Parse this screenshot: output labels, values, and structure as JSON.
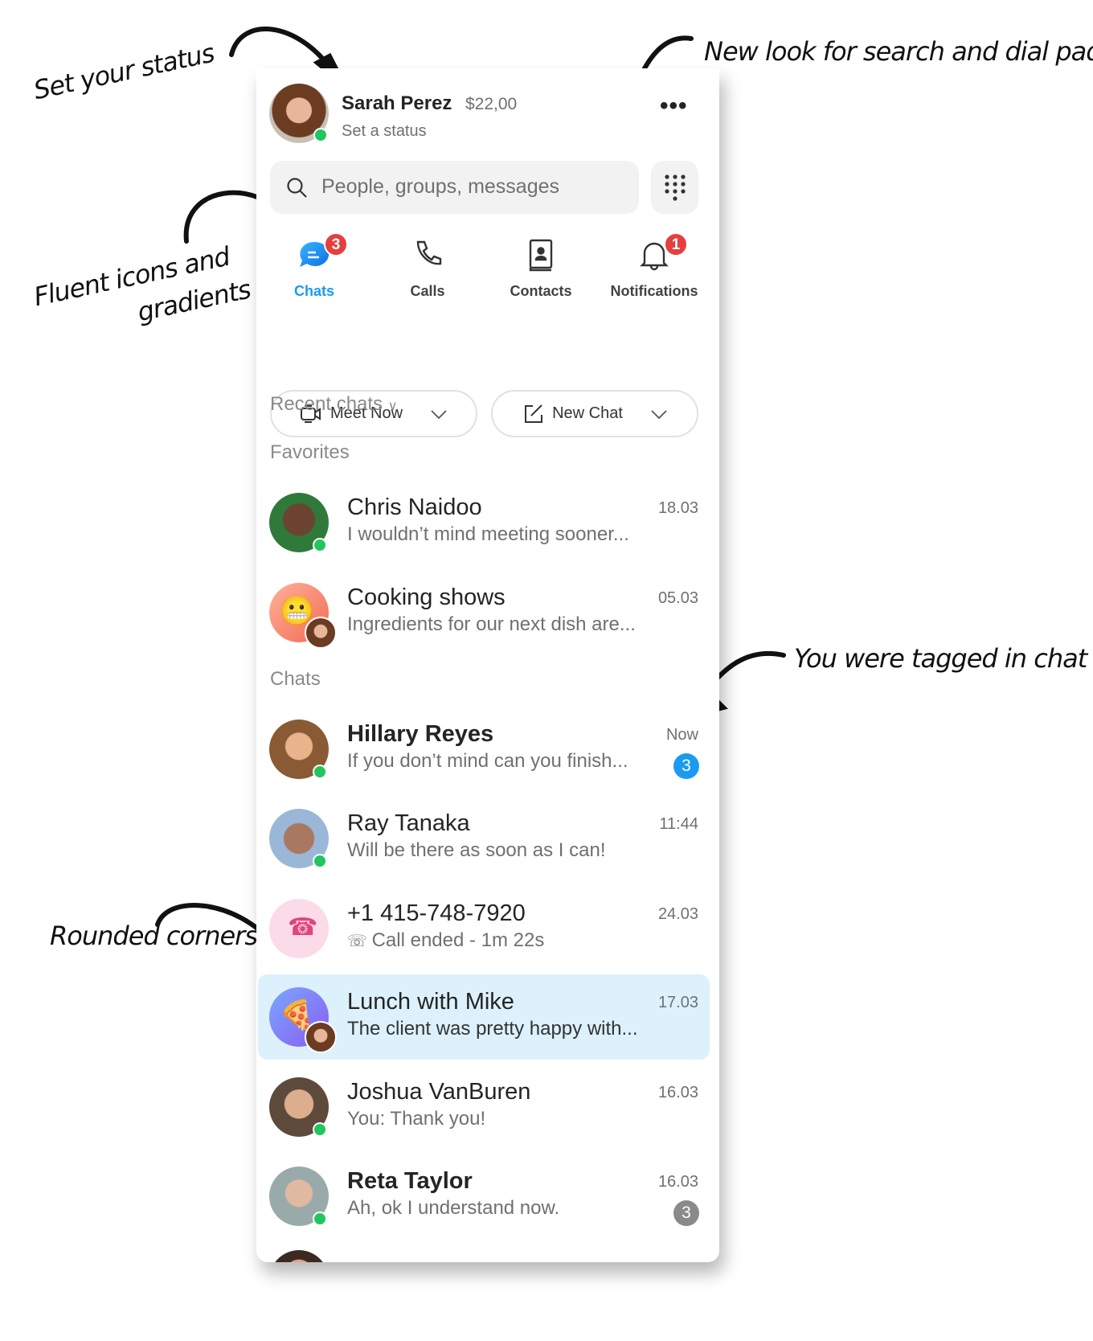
{
  "annotations": {
    "status": "Set your status",
    "search": "New look for search and dial pad",
    "icons_line1": "Fluent icons and",
    "icons_line2": "gradients",
    "tagged": "You were tagged in chat",
    "corners": "Rounded corners!"
  },
  "profile": {
    "name": "Sarah Perez",
    "credit": "$22,00",
    "status": "Set a status"
  },
  "search": {
    "placeholder": "People, groups, messages"
  },
  "tabs": [
    {
      "label": "Chats",
      "badge": "3",
      "active": true
    },
    {
      "label": "Calls"
    },
    {
      "label": "Contacts"
    },
    {
      "label": "Notifications",
      "badge": "1"
    }
  ],
  "buttons": {
    "meet_now": "Meet Now",
    "new_chat": "New Chat"
  },
  "sections": {
    "recent": "Recent chats",
    "favorites": "Favorites",
    "chats": "Chats"
  },
  "colors": {
    "accent": "#1a9bf0",
    "online": "#22c55e",
    "badge_red": "#e43f3f",
    "highlight": "#dcf1fc"
  },
  "favorites": [
    {
      "name": "Chris Naidoo",
      "message": "I wouldn’t mind meeting sooner...",
      "time": "18.03",
      "online": true
    },
    {
      "name": "Cooking shows",
      "message": "Ingredients for our next dish are...",
      "time": "05.03",
      "group": true
    }
  ],
  "chats": [
    {
      "name": "Hillary Reyes",
      "message": "If you don’t mind can you finish...",
      "time": "Now",
      "unread": "3",
      "tagged": true,
      "bold": true,
      "online": true
    },
    {
      "name": "Ray Tanaka",
      "message": "Will be there as soon as I can!",
      "time": "11:44",
      "online": true
    },
    {
      "name": "+1 415-748-7920",
      "message": "Call ended - 1m 22s",
      "time": "24.03",
      "phone": true
    },
    {
      "name": "Lunch with Mike",
      "message": "The client was pretty happy with...",
      "time": "17.03",
      "selected": true,
      "group": true
    },
    {
      "name": "Joshua VanBuren",
      "message": "You: Thank you!",
      "time": "16.03",
      "online": true
    },
    {
      "name": "Reta Taylor",
      "message": "Ah, ok I understand now.",
      "time": "16.03",
      "unread": "3",
      "bold": true,
      "online": true
    }
  ]
}
